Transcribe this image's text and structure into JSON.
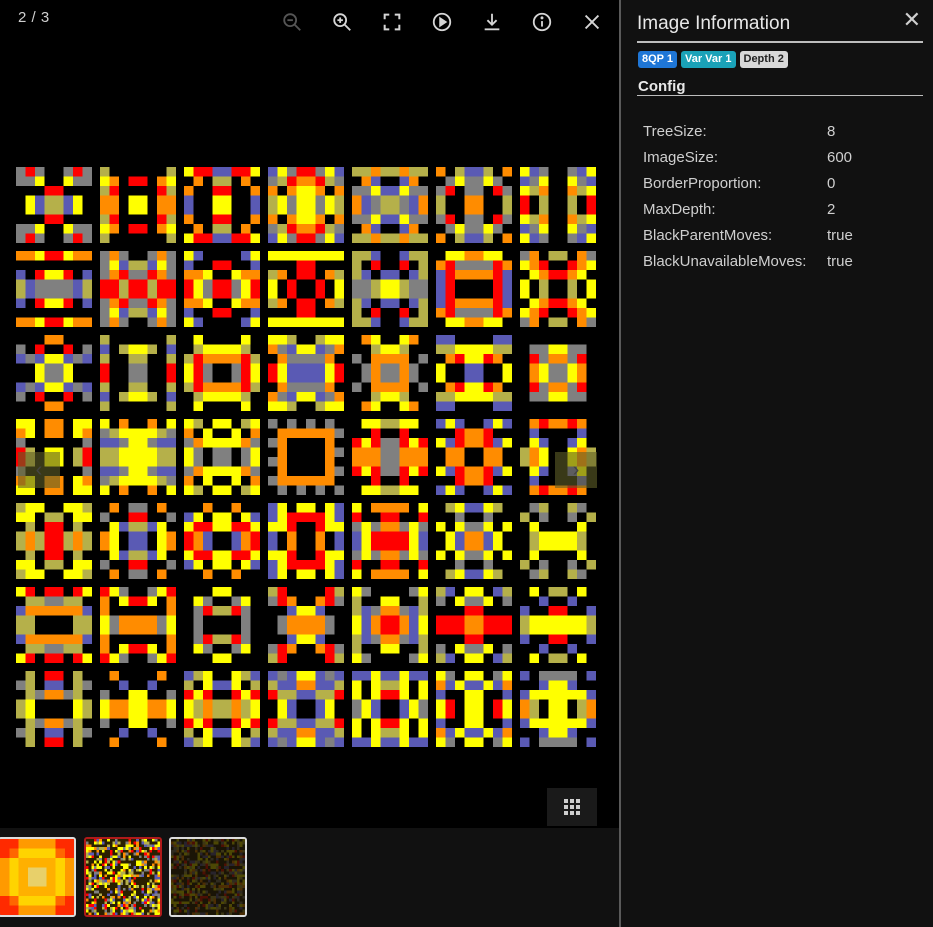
{
  "viewer": {
    "counter": "2 / 3",
    "toolbar": [
      {
        "name": "zoom-out-icon",
        "enabled": false
      },
      {
        "name": "zoom-in-icon",
        "enabled": true
      },
      {
        "name": "fullscreen-icon",
        "enabled": true
      },
      {
        "name": "slideshow-play-icon",
        "enabled": true
      },
      {
        "name": "download-icon",
        "enabled": true
      },
      {
        "name": "info-icon",
        "enabled": true
      },
      {
        "name": "close-icon",
        "enabled": true
      }
    ],
    "prev_icon": "chevron-left-icon",
    "next_icon": "chevron-right-icon",
    "grid_icon": "grid-icon"
  },
  "thumbnails": [
    {
      "name": "thumbnail-1",
      "active": false
    },
    {
      "name": "thumbnail-2",
      "active": true
    },
    {
      "name": "thumbnail-3",
      "active": false
    }
  ],
  "panel": {
    "title": "Image Information",
    "close_icon": "close-icon",
    "badges": [
      {
        "label": "8QP 1",
        "color": "#1f76d6"
      },
      {
        "label": "Var Var 1",
        "color": "#1aa2b8"
      },
      {
        "label": "Depth 2",
        "color": "#d8d8d8"
      }
    ],
    "section_title": "Config",
    "config": [
      {
        "key": "TreeSize:",
        "value": "8"
      },
      {
        "key": "ImageSize:",
        "value": "600"
      },
      {
        "key": "BorderProportion:",
        "value": "0"
      },
      {
        "key": "MaxDepth:",
        "value": "2"
      },
      {
        "key": "BlackParentMoves:",
        "value": "true"
      },
      {
        "key": "BlackUnavailableMoves:",
        "value": "true"
      }
    ]
  },
  "palette": {
    "yellow": "#ffff00",
    "olive": "#b5b04a",
    "red": "#ff0000",
    "orange": "#ff8c00",
    "blue": "#5a5ab4",
    "gray": "#808080",
    "black": "#000000"
  }
}
